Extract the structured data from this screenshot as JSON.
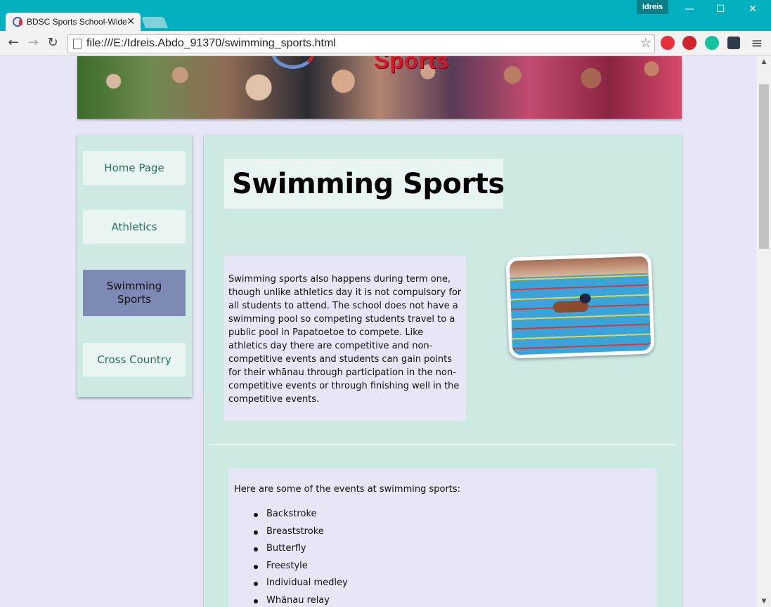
{
  "browser": {
    "tab_title": "BDSC Sports School-Wide",
    "tab_close": "✕",
    "user": "Idreis",
    "url": "file:///E:/Idreis.Abdo_91370/swimming_sports.html",
    "window_controls": {
      "minimize": "—",
      "maximize": "☐",
      "close": "✕"
    },
    "nav": {
      "back": "←",
      "forward": "→",
      "reload": "↻"
    },
    "star": "☆",
    "menu": "≡",
    "extensions": [
      {
        "name": "opera-extension-icon",
        "color": "#e8313e"
      },
      {
        "name": "lastpass-extension-icon",
        "color": "#d3212d"
      },
      {
        "name": "grammarly-extension-icon",
        "color": "#15c39a"
      },
      {
        "name": "puzzle-extension-icon",
        "color": "#2f3c48"
      }
    ]
  },
  "banner": {
    "brand_text": "Sports"
  },
  "sidebar": {
    "items": [
      {
        "label": "Home Page",
        "active": false
      },
      {
        "label": "Athletics",
        "active": false
      },
      {
        "label": "Swimming Sports",
        "active": true
      },
      {
        "label": "Cross Country",
        "active": false
      }
    ]
  },
  "main": {
    "title": "Swimming Sports",
    "intro": "Swimming sports also happens during term one, though unlike athletics day it is not compulsory for all students to attend. The school does not have a swimming pool so competing students travel to a public pool in Papatoetoe to compete. Like athletics day there are competitive and non-competitive events and students can gain points for their whānau through participation in the non-competitive events or through finishing well in the competitive events.",
    "events_intro": "Here are some of the events at swimming sports:",
    "events": [
      "Backstroke",
      "Breaststroke",
      "Butterfly",
      "Freestyle",
      "Individual medley",
      "Whānau relay"
    ]
  }
}
